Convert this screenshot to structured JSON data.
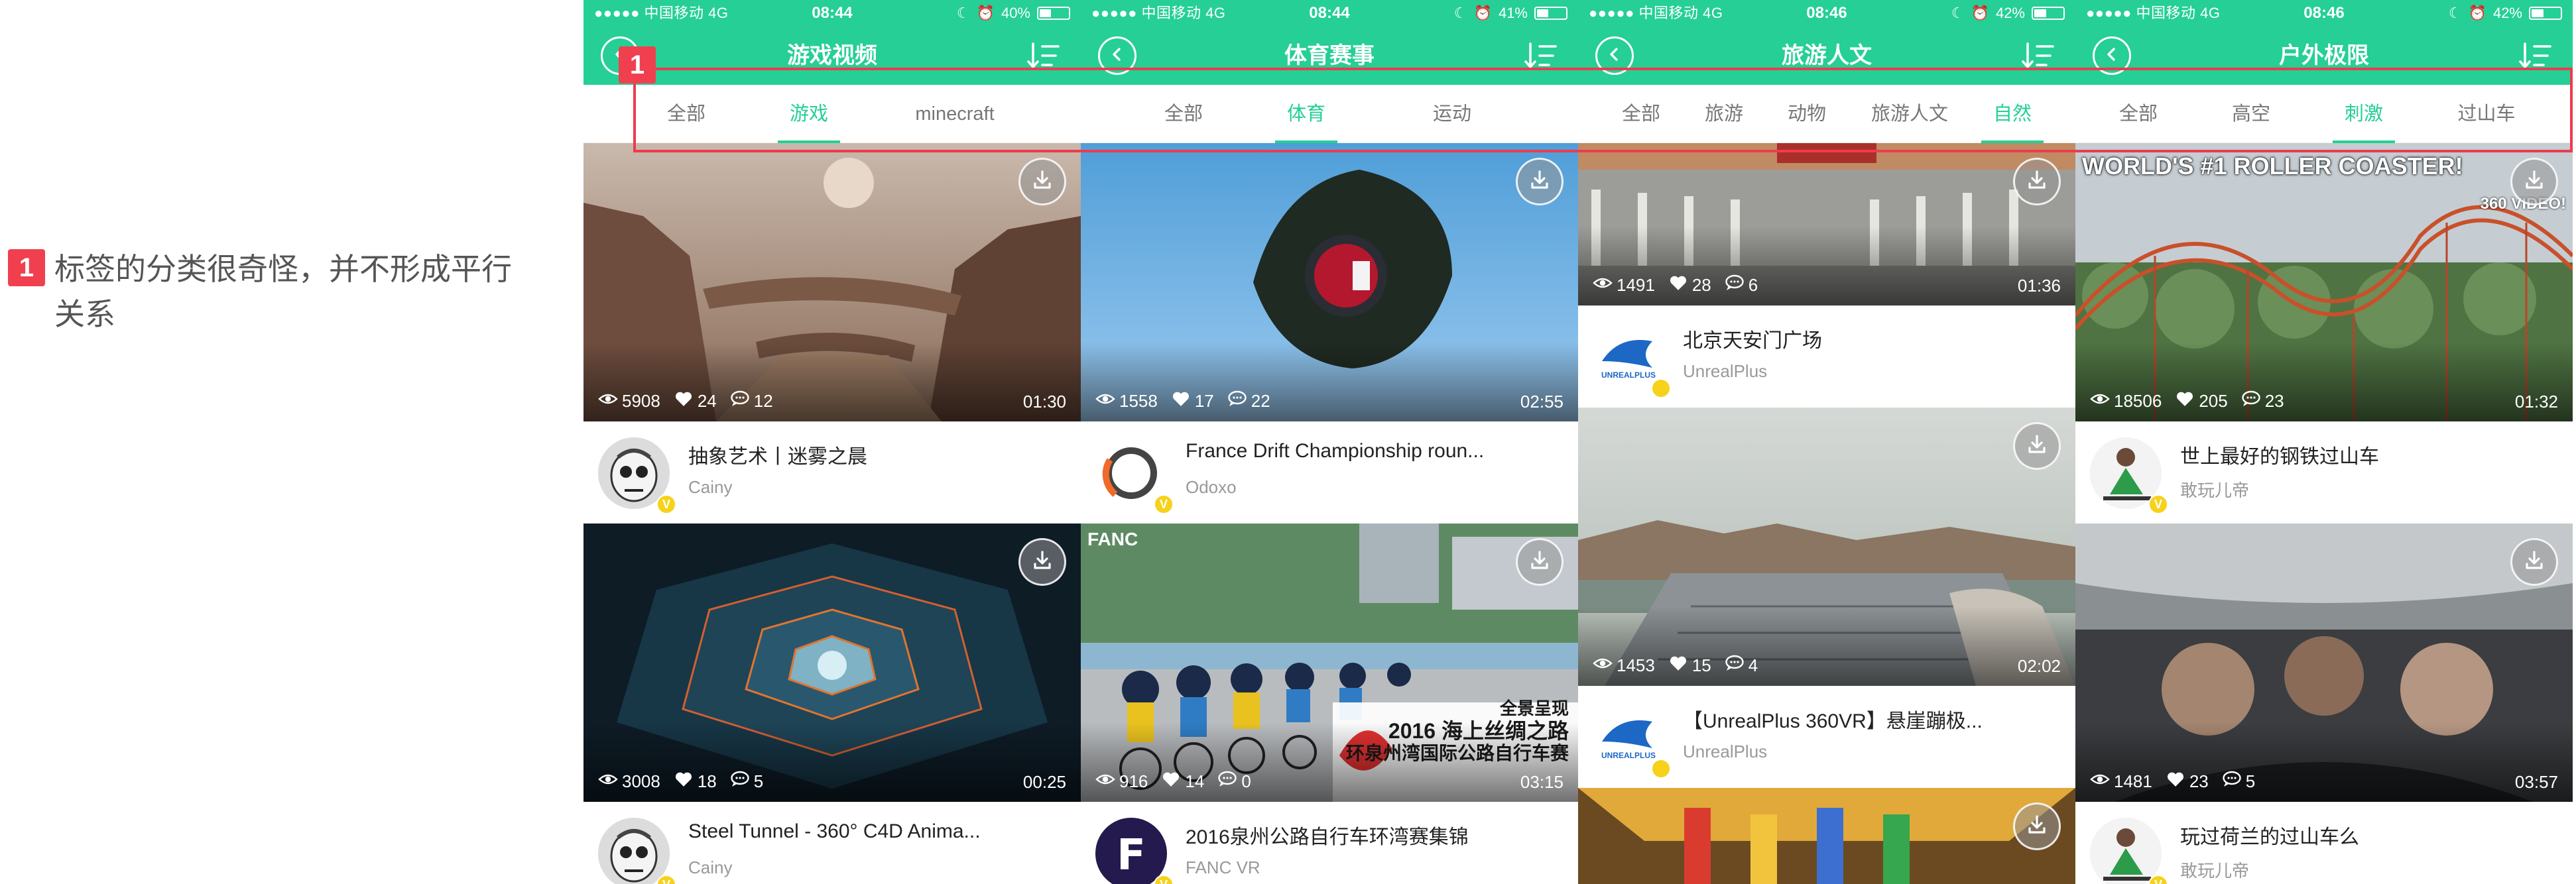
{
  "annotation": {
    "number": "1",
    "text": "标签的分类很奇怪，并不形成平行关系"
  },
  "colors": {
    "brand": "#25cf95",
    "highlight": "#ee3b4e",
    "badge_v": "#f6d21b"
  },
  "phones": [
    {
      "status": {
        "carrier": "●●●●● 中国移动  4G",
        "time": "08:44",
        "battery": "40%",
        "battery_level": 0.4
      },
      "title": "游戏视频",
      "tabs": [
        {
          "label": "全部"
        },
        {
          "label": "游戏",
          "active": true
        },
        {
          "label": "minecraft"
        }
      ],
      "cards": [
        {
          "views": "5908",
          "likes": "24",
          "comments": "12",
          "duration": "01:30",
          "title": "抽象艺术丨迷雾之晨",
          "author": "Cainy",
          "verified": "V",
          "thumb": "canyon"
        },
        {
          "views": "3008",
          "likes": "18",
          "comments": "5",
          "duration": "00:25",
          "title": "Steel Tunnel - 360° C4D Anima...",
          "author": "Cainy",
          "verified": "V",
          "thumb": "tunnel"
        }
      ]
    },
    {
      "status": {
        "carrier": "●●●●● 中国移动  4G",
        "time": "08:44",
        "battery": "41%",
        "battery_level": 0.41
      },
      "title": "体育赛事",
      "tabs": [
        {
          "label": "全部"
        },
        {
          "label": "体育",
          "active": true
        },
        {
          "label": "运动"
        }
      ],
      "cards": [
        {
          "views": "1558",
          "likes": "17",
          "comments": "22",
          "duration": "02:55",
          "title": "France Drift Championship roun...",
          "author": "Odoxo",
          "verified": "V",
          "thumb": "sphere"
        },
        {
          "views": "916",
          "likes": "14",
          "comments": "0",
          "duration": "03:15",
          "title": "2016泉州公路自行车环湾赛集锦",
          "author": "FANC VR",
          "verified": "V",
          "thumb": "cycling",
          "overlay_lines": [
            "全景呈现",
            "2016 海上丝绸之路",
            "环泉州湾国际公路自行车赛"
          ],
          "corner_text": "FANC"
        }
      ]
    },
    {
      "status": {
        "carrier": "●●●●● 中国移动  4G",
        "time": "08:46",
        "battery": "42%",
        "battery_level": 0.42
      },
      "title": "旅游人文",
      "tabs": [
        {
          "label": "全部"
        },
        {
          "label": "旅游"
        },
        {
          "label": "动物"
        },
        {
          "label": "旅游人文"
        },
        {
          "label": "自然",
          "active": true
        }
      ],
      "cards": [
        {
          "views": "1491",
          "likes": "28",
          "comments": "6",
          "duration": "01:36",
          "title": "北京天安门广场",
          "author": "UnrealPlus",
          "verified": "",
          "thumb": "square",
          "logo_text": "UNREALPLUS"
        },
        {
          "views": "1453",
          "likes": "15",
          "comments": "4",
          "duration": "02:02",
          "title": "【UnrealPlus 360VR】悬崖蹦极...",
          "author": "UnrealPlus",
          "verified": "",
          "thumb": "cliff",
          "logo_text": "UNREALPLUS"
        },
        {
          "thumb": "temple"
        }
      ]
    },
    {
      "status": {
        "carrier": "●●●●● 中国移动  4G",
        "time": "08:46",
        "battery": "42%",
        "battery_level": 0.42
      },
      "title": "户外极限",
      "tabs": [
        {
          "label": "全部"
        },
        {
          "label": "高空"
        },
        {
          "label": "刺激",
          "active": true
        },
        {
          "label": "过山车"
        }
      ],
      "cards": [
        {
          "views": "18506",
          "likes": "205",
          "comments": "23",
          "duration": "01:32",
          "title": "世上最好的钢铁过山车",
          "author": "敢玩儿帝",
          "verified": "V",
          "thumb": "coaster",
          "banner": "WORLD'S #1 ROLLER COASTER!",
          "badge360": "360 VIDEO!"
        },
        {
          "views": "1481",
          "likes": "23",
          "comments": "5",
          "duration": "03:57",
          "title": "玩过荷兰的过山车么",
          "author": "敢玩儿帝",
          "verified": "V",
          "thumb": "ride"
        }
      ]
    }
  ]
}
